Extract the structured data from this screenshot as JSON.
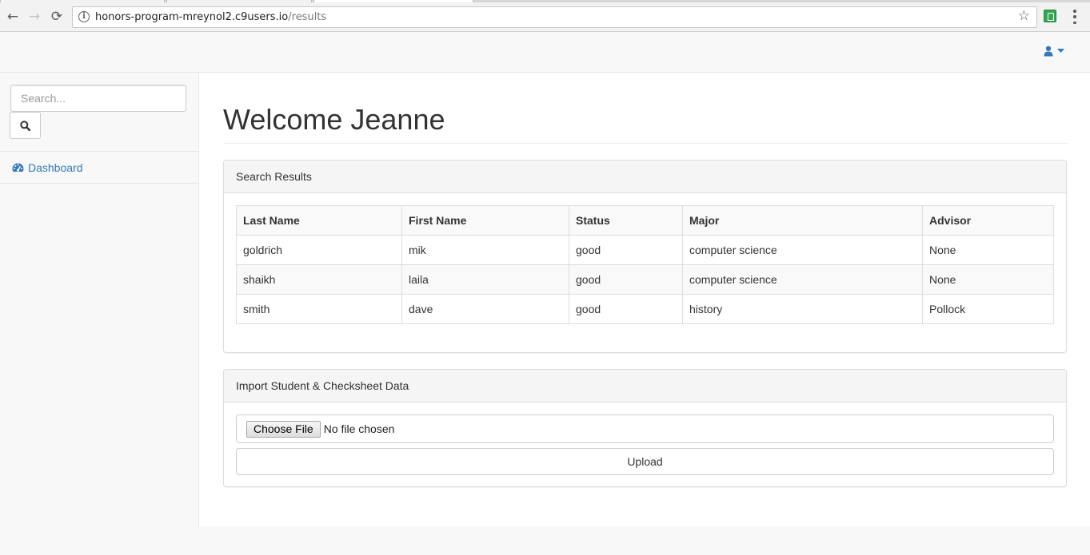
{
  "browser": {
    "url_host": "honors-program-mreynol2.c9users.io",
    "url_path": "/results",
    "back_icon": "←",
    "forward_icon": "→",
    "reload_icon": "⟳",
    "star_icon": "☆"
  },
  "navbar": {
    "user_icon": "user-icon",
    "caret_icon": "caret-down-icon"
  },
  "sidebar": {
    "search_placeholder": "Search...",
    "items": [
      {
        "label": "Dashboard",
        "icon": "dashboard-icon"
      }
    ]
  },
  "page": {
    "title": "Welcome Jeanne"
  },
  "results_panel": {
    "heading": "Search Results",
    "columns": [
      "Last Name",
      "First Name",
      "Status",
      "Major",
      "Advisor"
    ],
    "rows": [
      [
        "goldrich",
        "mik",
        "good",
        "computer science",
        "None"
      ],
      [
        "shaikh",
        "laila",
        "good",
        "computer science",
        "None"
      ],
      [
        "smith",
        "dave",
        "good",
        "history",
        "Pollock"
      ]
    ]
  },
  "import_panel": {
    "heading": "Import Student & Checksheet Data",
    "choose_file_label": "Choose File",
    "no_file_text": "No file chosen",
    "upload_label": "Upload"
  },
  "colors": {
    "link": "#337ab7",
    "panel_heading_bg": "#f5f5f5",
    "border": "#dddddd"
  }
}
